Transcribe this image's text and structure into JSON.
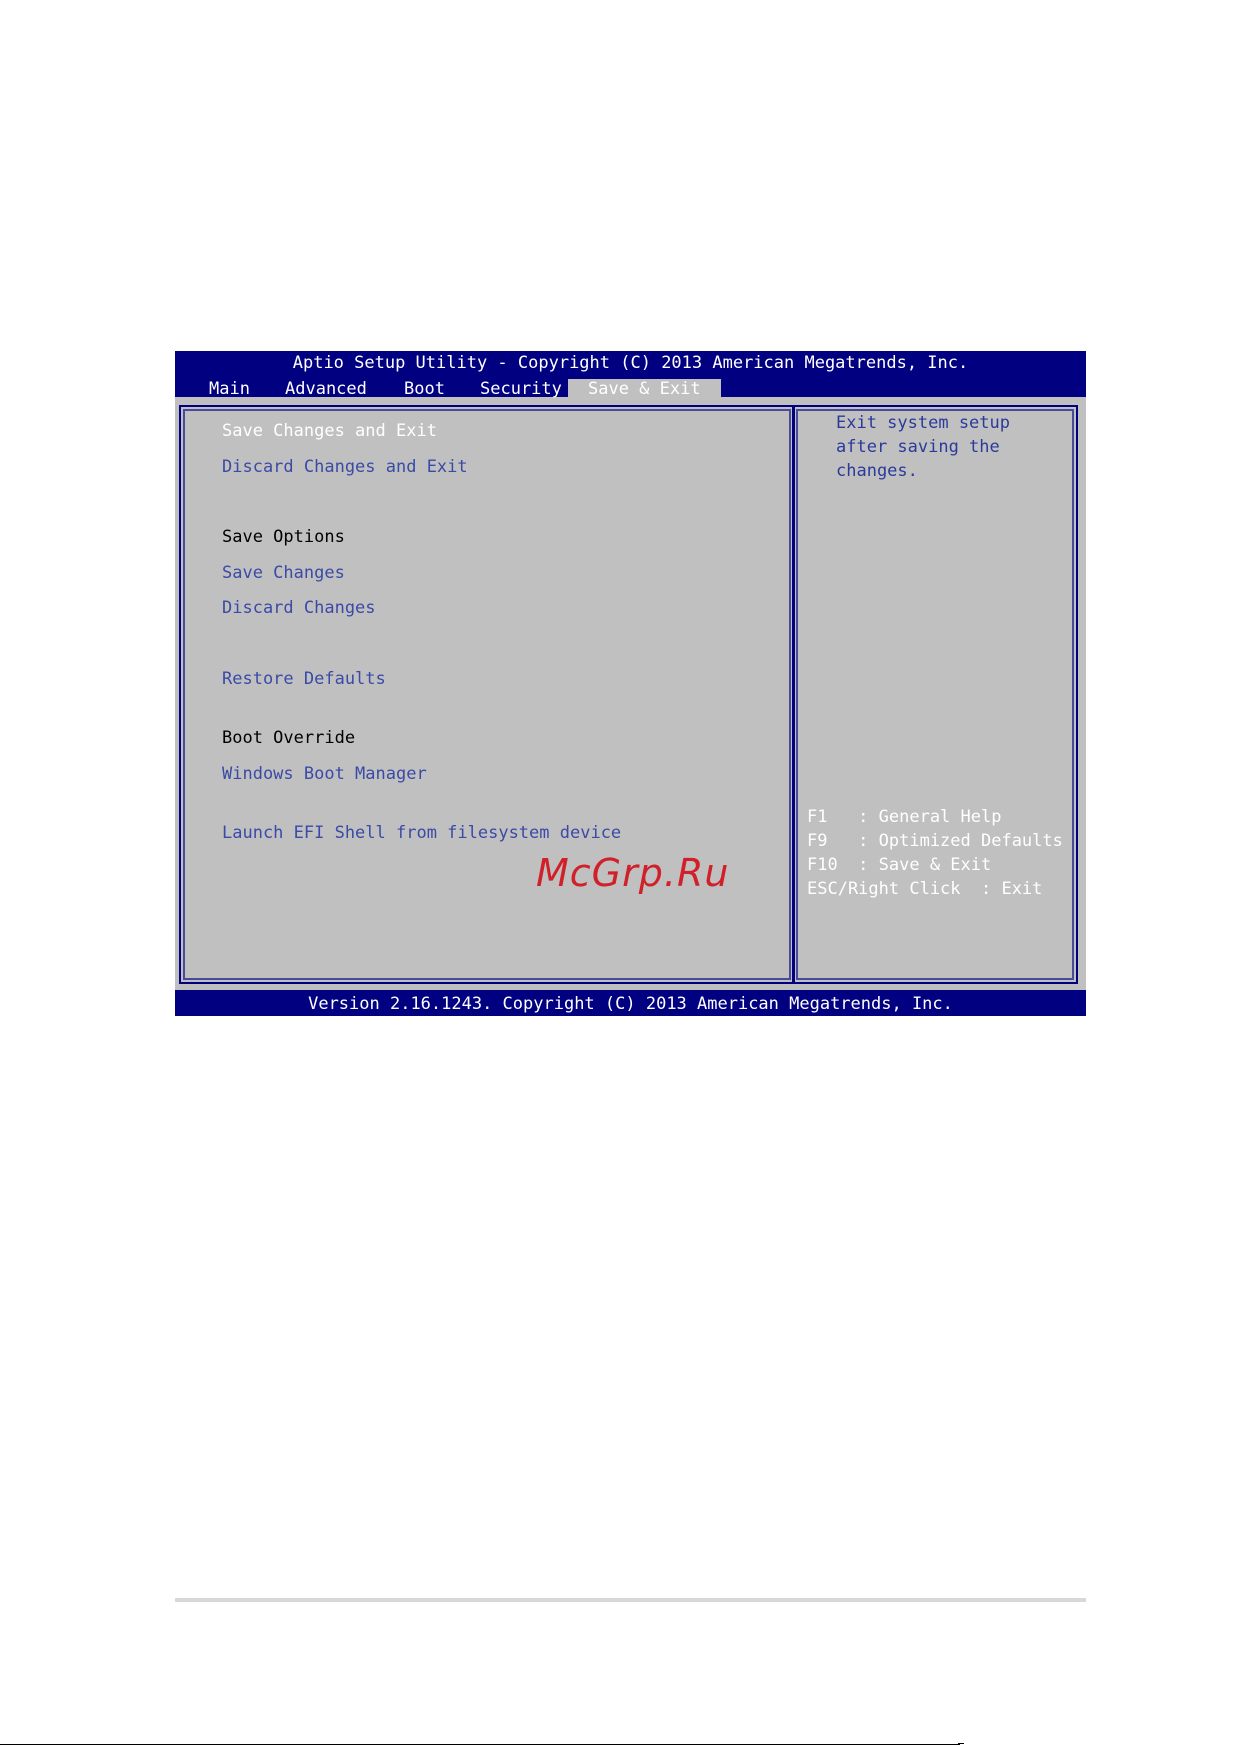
{
  "header": {
    "title": "Aptio Setup Utility - Copyright (C) 2013 American Megatrends, Inc."
  },
  "tabs": [
    {
      "label": "Main"
    },
    {
      "label": "Advanced"
    },
    {
      "label": "Boot"
    },
    {
      "label": "Security"
    },
    {
      "label": "Save & Exit",
      "active": true
    }
  ],
  "menu": {
    "save_changes_and_exit": "Save Changes and Exit",
    "discard_changes_and_exit": "Discard Changes and Exit",
    "save_options_heading": "Save Options",
    "save_changes": "Save Changes",
    "discard_changes": "Discard Changes",
    "restore_defaults": "Restore Defaults",
    "boot_override_heading": "Boot Override",
    "windows_boot_manager": "Windows Boot Manager",
    "launch_efi_shell": "Launch EFI Shell from filesystem device"
  },
  "help": {
    "text": "Exit system setup\nafter saving the\nchanges."
  },
  "keys": [
    "F1   : General Help",
    "F9   : Optimized Defaults",
    "F10  : Save & Exit",
    "ESC/Right Click  : Exit"
  ],
  "footer": {
    "version": "Version 2.16.1243. Copyright (C) 2013 American Megatrends, Inc."
  },
  "watermark": "McGrp.Ru",
  "colors": {
    "bar": "#000080",
    "panel": "#c0c0c0",
    "link": "#3a4aa6",
    "watermark": "#d0202a"
  }
}
